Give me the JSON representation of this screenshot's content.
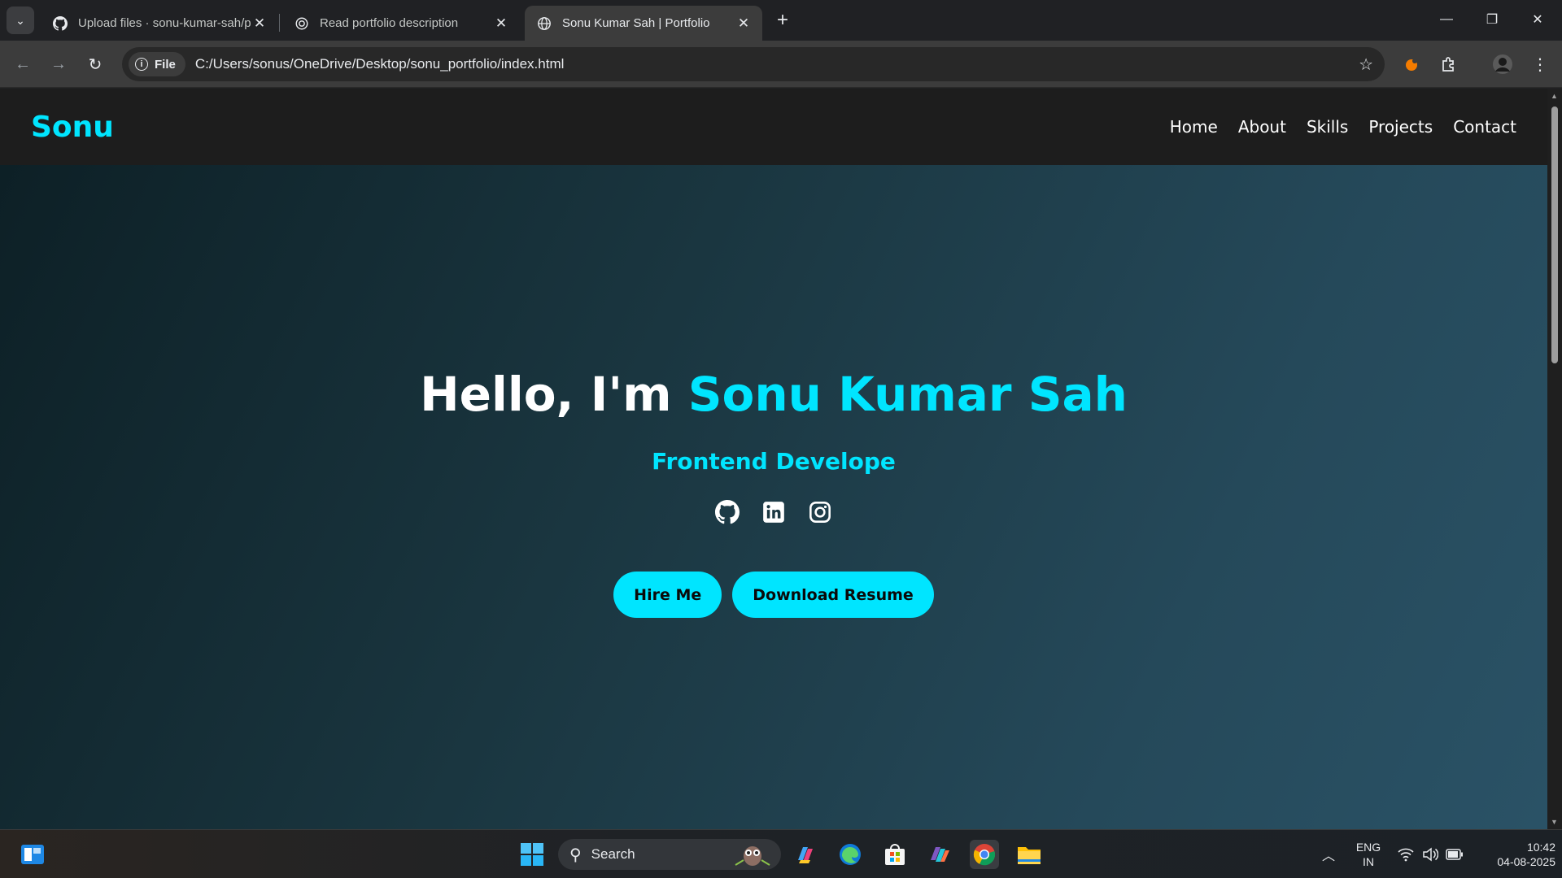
{
  "browser": {
    "tabs": [
      {
        "title": "Upload files · sonu-kumar-sah/p",
        "favicon": "github-icon"
      },
      {
        "title": "Read portfolio description",
        "favicon": "chatgpt-icon"
      },
      {
        "title": "Sonu Kumar Sah | Portfolio",
        "favicon": "globe-icon",
        "active": true
      }
    ],
    "address_chip": "File",
    "url": "C:/Users/sonus/OneDrive/Desktop/sonu_portfolio/index.html"
  },
  "site": {
    "logo": "Sonu",
    "nav": [
      "Home",
      "About",
      "Skills",
      "Projects",
      "Contact"
    ],
    "hero": {
      "greeting": "Hello, I'm ",
      "name": "Sonu Kumar Sah",
      "subtitle": "Frontend Develope",
      "socials": [
        "github-icon",
        "linkedin-icon",
        "instagram-icon"
      ],
      "buttons": {
        "hire": "Hire Me",
        "resume": "Download Resume"
      }
    },
    "colors": {
      "accent": "#00e5ff",
      "nav_bg": "#1d1d1d"
    }
  },
  "taskbar": {
    "search_placeholder": "Search",
    "lang_line1": "ENG",
    "lang_line2": "IN",
    "time": "10:42",
    "date": "04-08-2025"
  }
}
